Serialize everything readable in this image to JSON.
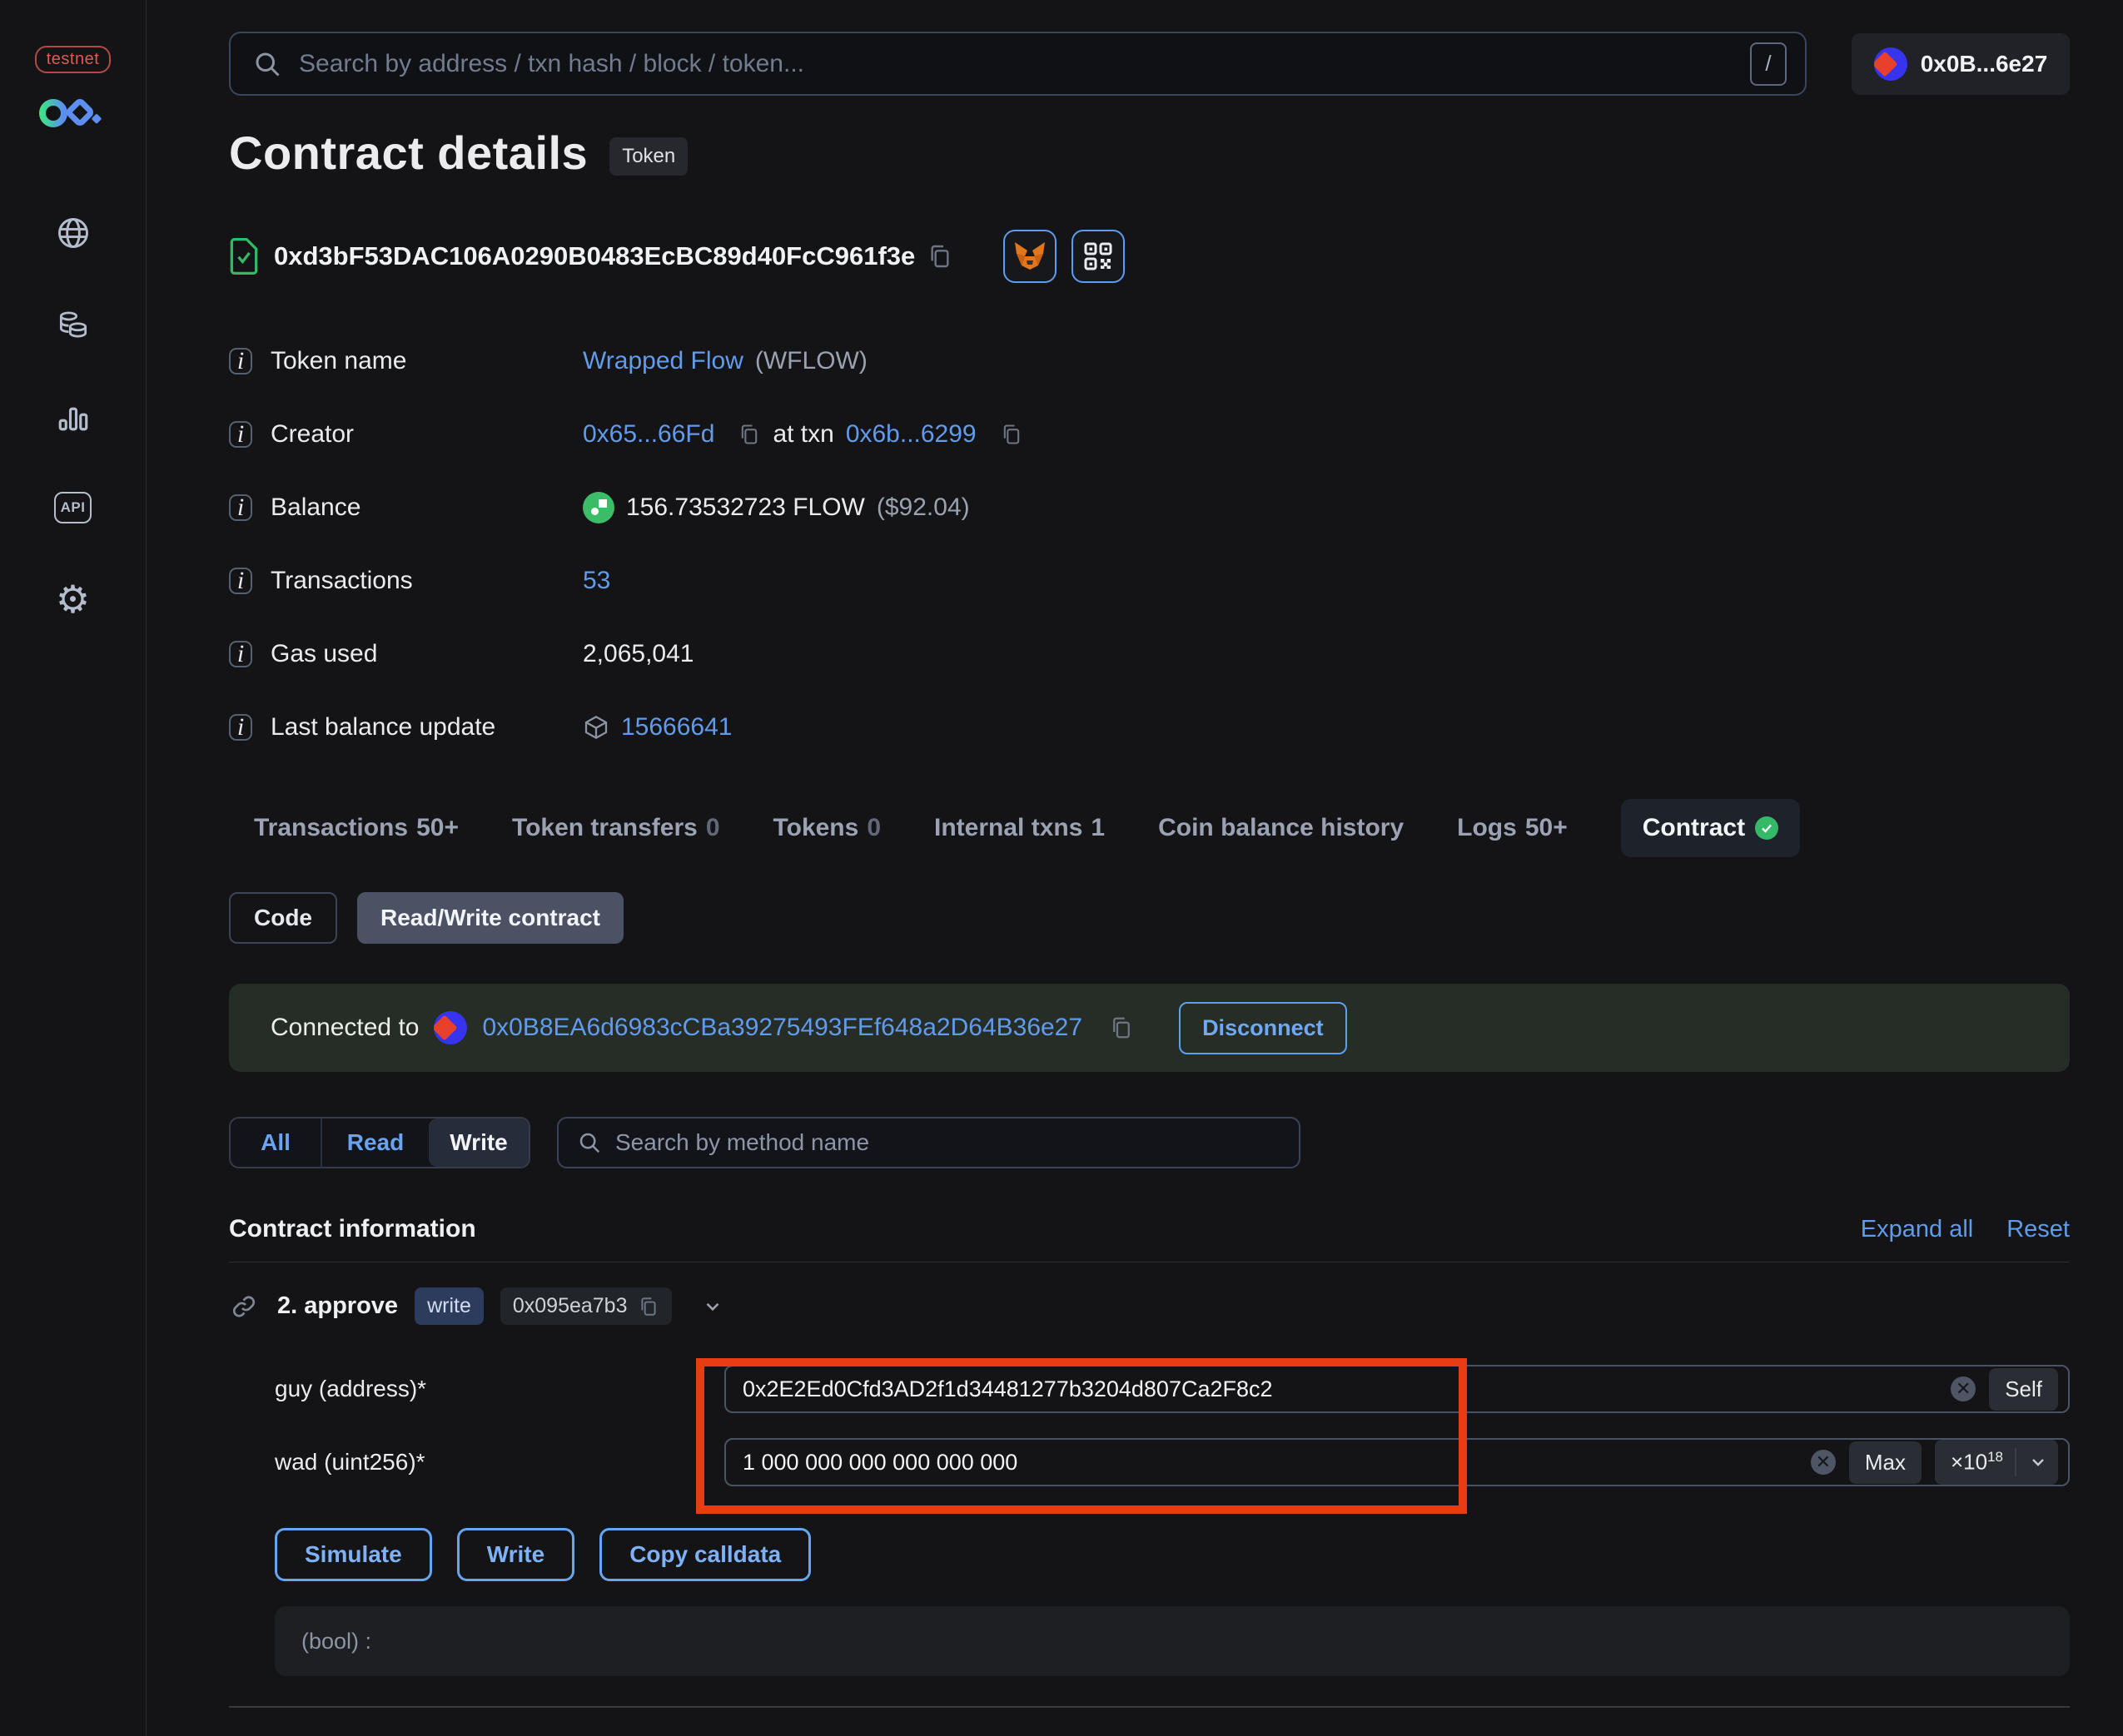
{
  "sidebar": {
    "network_badge": "testnet",
    "icons": [
      "globe-icon",
      "tokens-icon",
      "stats-icon",
      "api-icon",
      "settings-gear-icon"
    ],
    "api_label": "API"
  },
  "topbar": {
    "search_placeholder": "Search by address / txn hash / block / token...",
    "search_shortcut": "/",
    "account_label": "0x0B...6e27"
  },
  "page": {
    "title": "Contract details",
    "type_badge": "Token",
    "contract_address": "0xd3bF53DAC106A0290B0483EcBC89d40FcC961f3e"
  },
  "info": {
    "token_name": {
      "label": "Token name",
      "value": "Wrapped Flow",
      "symbol": "(WFLOW)"
    },
    "creator": {
      "label": "Creator",
      "address": "0x65...66Fd",
      "at_txn": "at txn",
      "txn": "0x6b...6299"
    },
    "balance": {
      "label": "Balance",
      "value": "156.73532723 FLOW",
      "usd": "($92.04)"
    },
    "transactions": {
      "label": "Transactions",
      "value": "53"
    },
    "gas_used": {
      "label": "Gas used",
      "value": "2,065,041"
    },
    "last_balance_update": {
      "label": "Last balance update",
      "value": "15666641"
    }
  },
  "tabs": [
    {
      "label": "Transactions",
      "count": "50+"
    },
    {
      "label": "Token transfers",
      "count": "0"
    },
    {
      "label": "Tokens",
      "count": "0"
    },
    {
      "label": "Internal txns",
      "count": "1"
    },
    {
      "label": "Coin balance history",
      "count": ""
    },
    {
      "label": "Logs",
      "count": "50+"
    },
    {
      "label": "Contract",
      "count": ""
    }
  ],
  "contract_tabs": {
    "code": "Code",
    "read_write": "Read/Write contract"
  },
  "connection": {
    "label": "Connected to",
    "address": "0x0B8EA6d6983cCBa39275493FEf648a2D64B36e27",
    "disconnect": "Disconnect"
  },
  "method_filter": {
    "all": "All",
    "read": "Read",
    "write": "Write",
    "search_placeholder": "Search by method name"
  },
  "section": {
    "heading": "Contract information",
    "expand_all": "Expand all",
    "reset": "Reset"
  },
  "method": {
    "name": "2. approve",
    "badge": "write",
    "selector": "0x095ea7b3"
  },
  "fields": {
    "guy": {
      "label": "guy (address)*",
      "value": "0x2E2Ed0Cfd3AD2f1d34481277b3204d807Ca2F8c2",
      "action": "Self"
    },
    "wad": {
      "label": "wad (uint256)*",
      "value": "1 000 000 000 000 000 000",
      "action": "Max",
      "multiplier": "×10",
      "exponent": "18"
    }
  },
  "actions": {
    "simulate": "Simulate",
    "write": "Write",
    "copy_calldata": "Copy calldata"
  },
  "output": {
    "result": "(bool) :"
  },
  "colors": {
    "accent": "#6aa5f2",
    "annotation": "#e83c12",
    "success": "#35b968",
    "testnet_red": "#e05a4f"
  }
}
